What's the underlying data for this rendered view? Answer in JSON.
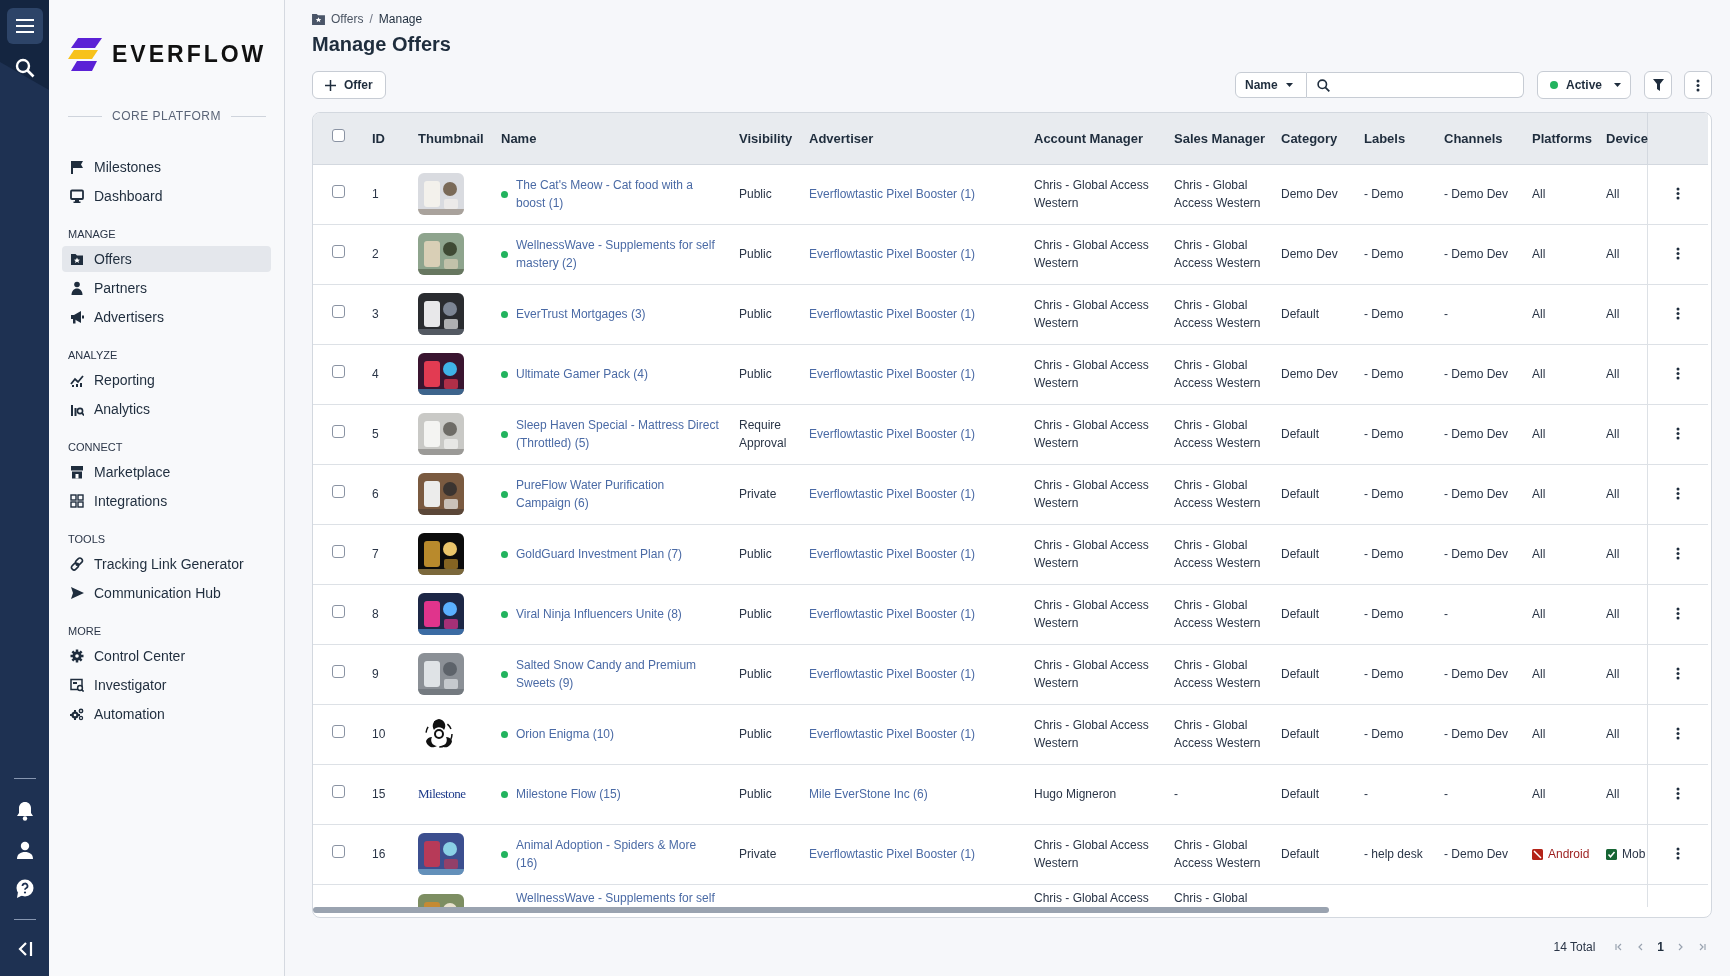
{
  "sidebar": {
    "brand": "EVERFLOW",
    "platform_label": "CORE PLATFORM",
    "sections": [
      {
        "items": [
          {
            "label": "Milestones",
            "selected": false
          },
          {
            "label": "Dashboard",
            "selected": false
          }
        ]
      },
      {
        "heading": "MANAGE",
        "items": [
          {
            "label": "Offers",
            "selected": true
          },
          {
            "label": "Partners",
            "selected": false
          },
          {
            "label": "Advertisers",
            "selected": false
          }
        ]
      },
      {
        "heading": "ANALYZE",
        "items": [
          {
            "label": "Reporting",
            "selected": false
          },
          {
            "label": "Analytics",
            "selected": false
          }
        ]
      },
      {
        "heading": "CONNECT",
        "items": [
          {
            "label": "Marketplace",
            "selected": false
          },
          {
            "label": "Integrations",
            "selected": false
          }
        ]
      },
      {
        "heading": "TOOLS",
        "items": [
          {
            "label": "Tracking Link Generator",
            "selected": false
          },
          {
            "label": "Communication Hub",
            "selected": false
          }
        ]
      },
      {
        "heading": "MORE",
        "items": [
          {
            "label": "Control Center",
            "selected": false
          },
          {
            "label": "Investigator",
            "selected": false
          },
          {
            "label": "Automation",
            "selected": false
          }
        ]
      }
    ]
  },
  "breadcrumb": {
    "items": [
      "Offers",
      "Manage"
    ],
    "separator": "/"
  },
  "title": "Manage Offers",
  "toolbar": {
    "add_button": "Offer",
    "search": {
      "field_selector": "Name"
    },
    "status_filter": {
      "label": "Active",
      "color": "#22b35e"
    }
  },
  "table": {
    "header_checked": false,
    "columns": [
      "ID",
      "Thumbnail",
      "Name",
      "Visibility",
      "Advertiser",
      "Account Manager",
      "Sales Manager",
      "Category",
      "Labels",
      "Channels",
      "Platforms",
      "Device"
    ],
    "rows": [
      {
        "checked": false,
        "id": "1",
        "name": "The Cat's Meow - Cat food with a boost (1)",
        "visibility": "Public",
        "advertiser": "Everflowtastic Pixel Booster (1)",
        "account_manager": "Chris - Global Access Western",
        "sales_manager": "Chris - Global Access Western",
        "category": "Demo Dev",
        "labels": "- Demo",
        "channels": "- Demo Dev",
        "platforms": {
          "text": "All",
          "kind": "plain"
        },
        "device": {
          "text": "All",
          "kind": "plain"
        }
      },
      {
        "checked": false,
        "id": "2",
        "name": "WellnessWave - Supplements for self mastery (2)",
        "visibility": "Public",
        "advertiser": "Everflowtastic Pixel Booster (1)",
        "account_manager": "Chris - Global Access Western",
        "sales_manager": "Chris - Global Access Western",
        "category": "Demo Dev",
        "labels": "- Demo",
        "channels": "- Demo Dev",
        "platforms": {
          "text": "All",
          "kind": "plain"
        },
        "device": {
          "text": "All",
          "kind": "plain"
        }
      },
      {
        "checked": false,
        "id": "3",
        "name": "EverTrust Mortgages (3)",
        "visibility": "Public",
        "advertiser": "Everflowtastic Pixel Booster (1)",
        "account_manager": "Chris - Global Access Western",
        "sales_manager": "Chris - Global Access Western",
        "category": "Default",
        "labels": "- Demo",
        "channels": "-",
        "platforms": {
          "text": "All",
          "kind": "plain"
        },
        "device": {
          "text": "All",
          "kind": "plain"
        }
      },
      {
        "checked": false,
        "id": "4",
        "name": "Ultimate Gamer Pack (4)",
        "visibility": "Public",
        "advertiser": "Everflowtastic Pixel Booster (1)",
        "account_manager": "Chris - Global Access Western",
        "sales_manager": "Chris - Global Access Western",
        "category": "Demo Dev",
        "labels": "- Demo",
        "channels": "- Demo Dev",
        "platforms": {
          "text": "All",
          "kind": "plain"
        },
        "device": {
          "text": "All",
          "kind": "plain"
        }
      },
      {
        "checked": false,
        "id": "5",
        "name": "Sleep Haven Special - Mattress Direct (Throttled) (5)",
        "visibility": "Require Approval",
        "advertiser": "Everflowtastic Pixel Booster (1)",
        "account_manager": "Chris - Global Access Western",
        "sales_manager": "Chris - Global Access Western",
        "category": "Default",
        "labels": "- Demo",
        "channels": "- Demo Dev",
        "platforms": {
          "text": "All",
          "kind": "plain"
        },
        "device": {
          "text": "All",
          "kind": "plain"
        }
      },
      {
        "checked": false,
        "id": "6",
        "name": "PureFlow Water Purification Campaign (6)",
        "visibility": "Private",
        "advertiser": "Everflowtastic Pixel Booster (1)",
        "account_manager": "Chris - Global Access Western",
        "sales_manager": "Chris - Global Access Western",
        "category": "Default",
        "labels": "- Demo",
        "channels": "- Demo Dev",
        "platforms": {
          "text": "All",
          "kind": "plain"
        },
        "device": {
          "text": "All",
          "kind": "plain"
        }
      },
      {
        "checked": false,
        "id": "7",
        "name": "GoldGuard Investment Plan (7)",
        "visibility": "Public",
        "advertiser": "Everflowtastic Pixel Booster (1)",
        "account_manager": "Chris - Global Access Western",
        "sales_manager": "Chris - Global Access Western",
        "category": "Default",
        "labels": "- Demo",
        "channels": "- Demo Dev",
        "platforms": {
          "text": "All",
          "kind": "plain"
        },
        "device": {
          "text": "All",
          "kind": "plain"
        }
      },
      {
        "checked": false,
        "id": "8",
        "name": "Viral Ninja Influencers Unite (8)",
        "visibility": "Public",
        "advertiser": "Everflowtastic Pixel Booster (1)",
        "account_manager": "Chris - Global Access Western",
        "sales_manager": "Chris - Global Access Western",
        "category": "Default",
        "labels": "- Demo",
        "channels": "-",
        "platforms": {
          "text": "All",
          "kind": "plain"
        },
        "device": {
          "text": "All",
          "kind": "plain"
        }
      },
      {
        "checked": false,
        "id": "9",
        "name": "Salted Snow Candy and Premium Sweets (9)",
        "visibility": "Public",
        "advertiser": "Everflowtastic Pixel Booster (1)",
        "account_manager": "Chris - Global Access Western",
        "sales_manager": "Chris - Global Access Western",
        "category": "Default",
        "labels": "- Demo",
        "channels": "- Demo Dev",
        "platforms": {
          "text": "All",
          "kind": "plain"
        },
        "device": {
          "text": "All",
          "kind": "plain"
        }
      },
      {
        "checked": false,
        "id": "10",
        "thumbnail": {
          "kind": "symbol"
        },
        "name": "Orion Enigma (10)",
        "visibility": "Public",
        "advertiser": "Everflowtastic Pixel Booster (1)",
        "account_manager": "Chris - Global Access Western",
        "sales_manager": "Chris - Global Access Western",
        "category": "Default",
        "labels": "- Demo",
        "channels": "- Demo Dev",
        "platforms": {
          "text": "All",
          "kind": "plain"
        },
        "device": {
          "text": "All",
          "kind": "plain"
        }
      },
      {
        "checked": false,
        "id": "15",
        "thumbnail": {
          "kind": "wordmark",
          "text": "Milestone"
        },
        "name": "Milestone Flow (15)",
        "visibility": "Public",
        "advertiser": "Mile EverStone Inc (6)",
        "account_manager": "Hugo Migneron",
        "sales_manager": "-",
        "category": "Default",
        "labels": "-",
        "channels": "-",
        "platforms": {
          "text": "All",
          "kind": "plain"
        },
        "device": {
          "text": "All",
          "kind": "plain"
        }
      },
      {
        "checked": false,
        "id": "16",
        "name": "Animal Adoption - Spiders & More (16)",
        "visibility": "Private",
        "advertiser": "Everflowtastic Pixel Booster (1)",
        "account_manager": "Chris - Global Access Western",
        "sales_manager": "Chris - Global Access Western",
        "category": "Default",
        "labels": "- help desk",
        "channels": "- Demo Dev",
        "platforms": {
          "text": "Android",
          "kind": "excluded"
        },
        "device": {
          "text": "Mob",
          "kind": "included"
        }
      },
      {
        "name": "WellnessWave - Supplements for self",
        "account_manager": "Chris - Global Access",
        "sales_manager": "Chris - Global"
      }
    ]
  },
  "pagination": {
    "total": "14 Total",
    "page": "1"
  }
}
